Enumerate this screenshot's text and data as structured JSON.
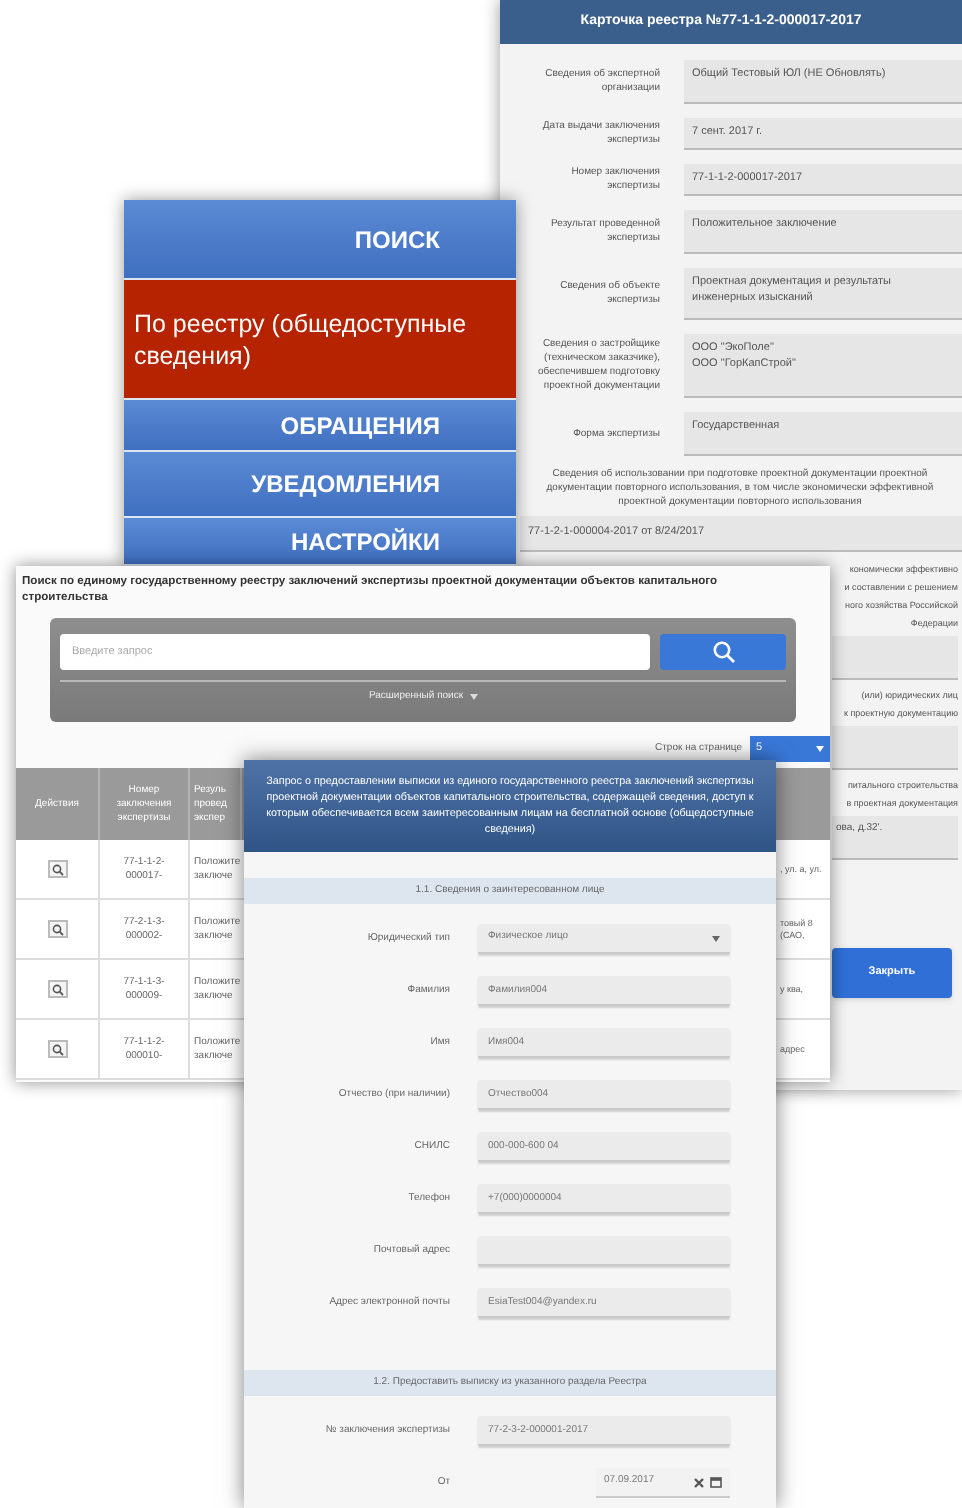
{
  "registry_card": {
    "title": "Карточка реестра №77-1-1-2-000017-2017",
    "fields": [
      {
        "label": "Сведения об экспертной организации",
        "value": "Общий Тестовый ЮЛ (НЕ Обновлять)"
      },
      {
        "label": "Дата выдачи заключения экспертизы",
        "value": "7 сент. 2017 г."
      },
      {
        "label": "Номер заключения экспертизы",
        "value": "77-1-1-2-000017-2017"
      },
      {
        "label": "Результат проведенной экспертизы",
        "value": "Положительное заключение"
      },
      {
        "label": "Сведения об объекте экспертизы",
        "value": "Проектная документация и результаты инженерных изысканий"
      },
      {
        "label": "Сведения о застройщике (техническом заказчике), обеспечившем подготовку проектной документации",
        "value": "ООО \"ЭкоПоле\"\nООО \"ГорКапСтрой\""
      },
      {
        "label": "Форма экспертизы",
        "value": "Государственная"
      }
    ],
    "reuse_note": "Сведения об использовании при подготовке проектной документации проектной документации повторного использования, в том числе экономически эффективной проектной документации повторного использования",
    "reuse_value": "77-1-2-1-000004-2017 от 8/24/2017",
    "lower_blocks": [
      {
        "lines": [
          "кономически эффективно",
          "и составлении с решением",
          "ного хозяйства Российской",
          "Федерации"
        ]
      },
      {
        "lines": [
          "(или) юридических лиц",
          "к проектную документацию"
        ]
      },
      {
        "lines": [
          "питального строительства",
          "в проектная документация"
        ],
        "value": "ова, д.32'."
      }
    ],
    "close_button": "Закрыть"
  },
  "nav_menu": {
    "items": [
      {
        "label": "ПОИСК",
        "kind": "header",
        "selected": false
      },
      {
        "label": "По реестру (общедоступные сведения)",
        "kind": "item",
        "selected": true
      },
      {
        "label": "ОБРАЩЕНИЯ",
        "kind": "header",
        "selected": false
      },
      {
        "label": "УВЕДОМЛЕНИЯ",
        "kind": "header",
        "selected": false
      },
      {
        "label": "НАСТРОЙКИ",
        "kind": "header",
        "selected": false
      }
    ]
  },
  "search_panel": {
    "title": "Поиск по единому государственному реестру заключений экспертизы проектной документации объектов капитального строительства",
    "search": {
      "placeholder": "Введите запрос"
    },
    "advanced_search": "Расширенный поиск",
    "rows_per_page": {
      "label": "Строк на странице",
      "value": "5"
    },
    "table": {
      "columns": [
        "Действия",
        "Номер заключения экспертизы",
        "Резуль провед экспер"
      ],
      "rows": [
        {
          "number": "77-1-1-2-000017-",
          "result": "Положите заключе",
          "column_4": ", ул. а, ул."
        },
        {
          "number": "77-2-1-3-000002-",
          "result": "Положите заключе",
          "column_4": "товый 8 (САО,"
        },
        {
          "number": "77-1-1-3-000009-",
          "result": "Положите заключе",
          "column_4": "у ква,"
        },
        {
          "number": "77-1-1-2-000010-",
          "result": "Положите заключе",
          "column_4": "адрес"
        }
      ]
    }
  },
  "request_form": {
    "title": "Запрос о предоставлении выписки из единого государственного реестра заключений экспертизы проектной документации объектов капитального строительства, содержащей сведения, доступ к которым обеспечивается всем заинтересованным лицам на бесплатной основе (общедоступные сведения)",
    "sections": [
      {
        "title": "1.1. Сведения о заинтересованном лице",
        "fields": [
          {
            "kind": "select",
            "label": "Юридический тип",
            "value": "Физическое лицо"
          },
          {
            "kind": "text",
            "label": "Фамилия",
            "value": "Фамилия004"
          },
          {
            "kind": "text",
            "label": "Имя",
            "value": "Имя004"
          },
          {
            "kind": "text",
            "label": "Отчество (при наличии)",
            "value": "Отчество004"
          },
          {
            "kind": "text",
            "label": "СНИЛС",
            "value": "000-000-600 04"
          },
          {
            "kind": "text",
            "label": "Телефон",
            "value": "+7(000)0000004"
          },
          {
            "kind": "text",
            "label": "Почтовый адрес"
          },
          {
            "kind": "text",
            "label": "Адрес электронной почты",
            "value": "EsiaTest004@yandex.ru"
          }
        ]
      },
      {
        "title": "1.2. Предоставить выписку из указанного раздела Реестра",
        "fields": [
          {
            "kind": "text",
            "label": "№ заключения экспертизы",
            "value": "77-2-3-2-000001-2017"
          },
          {
            "kind": "date",
            "label": "От",
            "value": "07.09.2017"
          }
        ]
      }
    ]
  }
}
